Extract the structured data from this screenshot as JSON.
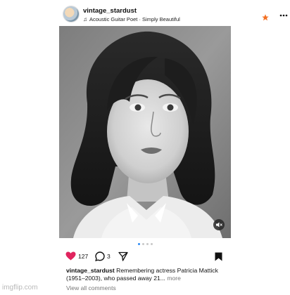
{
  "post": {
    "username": "vintage_stardust",
    "music": "Acoustic Guitar Poet · Simply Beautiful",
    "icons": {
      "avatar": "avatar-icon",
      "music": "music-note-icon",
      "badge": "star-icon",
      "menu": "more-icon",
      "mute": "muted-speaker-icon",
      "like": "heart-icon",
      "comment": "comment-icon",
      "share": "send-icon",
      "save": "bookmark-icon"
    },
    "carousel": {
      "count": 4,
      "active": 1
    },
    "likes": "127",
    "comments_count": "3",
    "caption_user": "vintage_stardust",
    "caption_text": " Remembering actress Patricia Mattick (1951–2003), who passed away 21...",
    "more_label": " more",
    "view_comments": "View all comments"
  },
  "colors": {
    "like": "#e0245e",
    "badge": "#f36f21",
    "active_dot": "#2f8cf5"
  },
  "watermark": "imgflip.com"
}
